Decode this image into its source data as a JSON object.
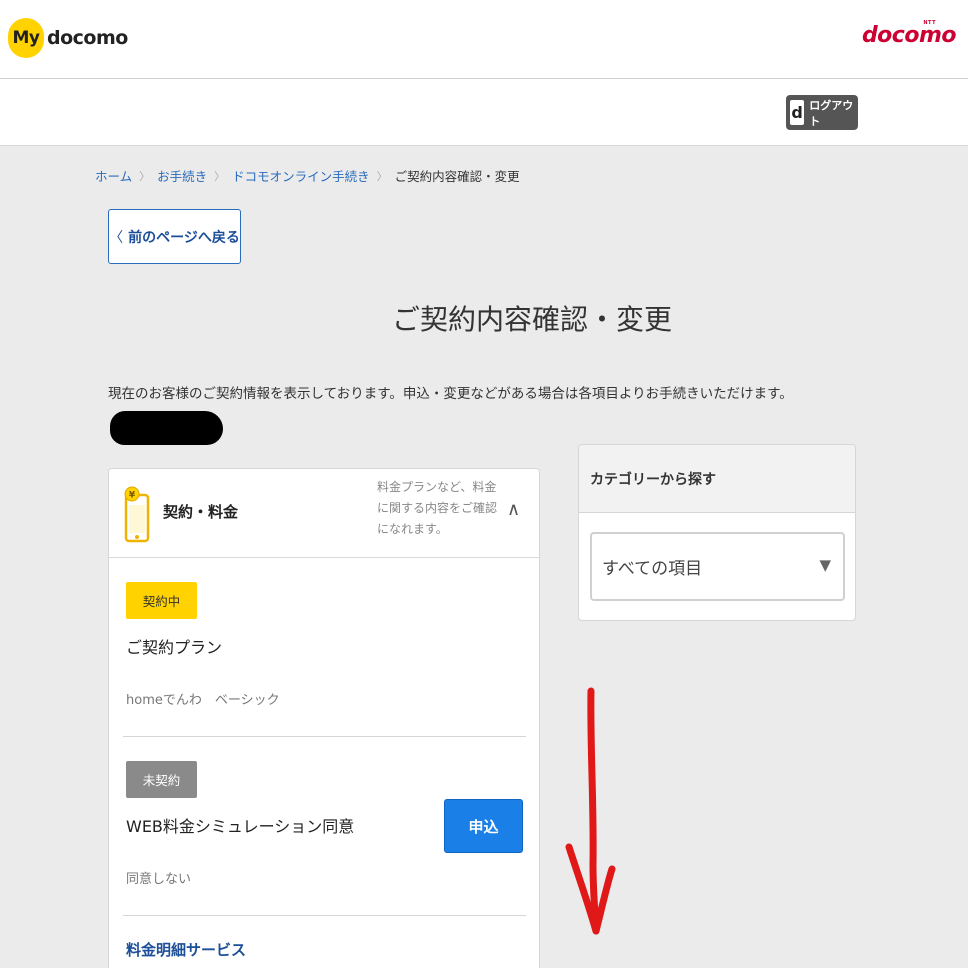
{
  "header": {
    "logo_my": "My",
    "logo_text": "docomo",
    "brand_ntt": "NTT",
    "brand_name": "docomo"
  },
  "account_bar": {
    "logout_icon_letter": "d",
    "logout_label": "ログアウト"
  },
  "breadcrumb": [
    "ホーム",
    "お手続き",
    "ドコモオンライン手続き",
    "ご契約内容確認・変更"
  ],
  "back_button": {
    "label": "前のページへ戻る"
  },
  "page_title": "ご契約内容確認・変更",
  "intro_text": "現在のお客様のご契約情報を表示しております。申込・変更などがある場合は各項目よりお手続きいただけます。",
  "contract_section": {
    "title": "契約・料金",
    "description": "料金プランなど、料金に関する内容をご確認になれます。",
    "icon": "phone-yen-icon",
    "items": [
      {
        "status": "契約中",
        "name": "ご契約プラン",
        "value": "homeでんわ　ベーシック"
      },
      {
        "status": "未契約",
        "name": "WEB料金シミュレーション同意",
        "value": "同意しない",
        "action_label": "申込"
      }
    ],
    "next_item_label": "料金明細サービス"
  },
  "category_search": {
    "heading": "カテゴリーから探す",
    "selected": "すべての項目"
  },
  "colors": {
    "brand_red": "#cc0033",
    "accent_yellow": "#ffd200",
    "link_blue": "#2a6bbb",
    "button_blue": "#1a7fe6",
    "annotation_red": "#e01818"
  }
}
